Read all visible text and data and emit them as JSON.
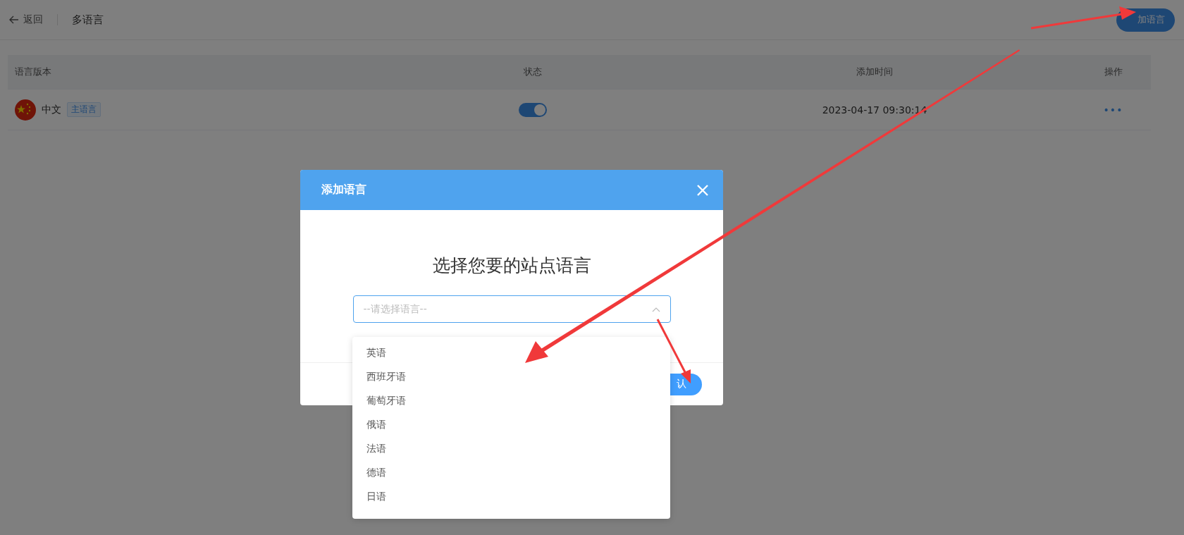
{
  "header": {
    "back": "返回",
    "title": "多语言",
    "add_button": "加语言"
  },
  "table": {
    "columns": [
      "语言版本",
      "状态",
      "添加时间",
      "操作"
    ],
    "rows": [
      {
        "language": "中文",
        "tag": "主语言",
        "on": true,
        "added": "2023-04-17 09:30:14",
        "actions": "•••"
      }
    ]
  },
  "modal": {
    "title": "添加语言",
    "heading": "选择您要的站点语言",
    "select": {
      "placeholder": "--请选择语言--",
      "expanded": true
    },
    "options": [
      {
        "label": "英语",
        "selected": false
      },
      {
        "label": "西班牙语",
        "selected": false
      },
      {
        "label": "葡萄牙语",
        "selected": false
      },
      {
        "label": "俄语",
        "selected": false
      },
      {
        "label": "法语",
        "selected": false
      },
      {
        "label": "德语",
        "selected": false
      },
      {
        "label": "日语",
        "selected": false
      }
    ],
    "confirm": "认"
  }
}
